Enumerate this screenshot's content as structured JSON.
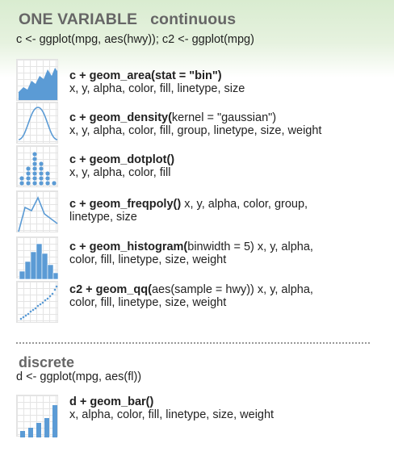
{
  "header": {
    "title_main": "ONE VARIABLE",
    "title_sub": "continuous",
    "code": "c <- ggplot(mpg, aes(hwy)); c2 <- ggplot(mpg)"
  },
  "entries": [
    {
      "call": "c + geom_area(stat = \"bin\")",
      "args_inline": "",
      "args": "x, y, alpha, color, fill,  linetype, size",
      "icon": "area-chart-icon"
    },
    {
      "call": "c + geom_density(",
      "args_inline": "kernel = \"gaussian\")",
      "args": "x, y, alpha, color, fill, group, linetype, size, weight",
      "icon": "density-curve-icon"
    },
    {
      "call": "c + geom_dotplot()",
      "args_inline": "",
      "args": "x, y, alpha, color, fill",
      "icon": "dotplot-icon"
    },
    {
      "call": "c + geom_freqpoly()",
      "args_inline": " x, y, alpha, color, group,",
      "args": "linetype, size",
      "icon": "freqpoly-icon"
    },
    {
      "call": "c + geom_histogram(",
      "args_inline": "binwidth = 5) x, y, alpha,",
      "args": "color, fill, linetype, size, weight",
      "icon": "histogram-icon"
    },
    {
      "call": "c2 + geom_qq(",
      "args_inline": "aes(sample = hwy)) x, y, alpha,",
      "args": "color, fill, linetype, size, weight",
      "icon": "qq-plot-icon"
    }
  ],
  "discrete": {
    "title": "discrete",
    "code": "d <- ggplot(mpg, aes(fl))",
    "entry": {
      "call": "d + geom_bar()",
      "args": "x, alpha, color, fill, linetype, size, weight",
      "icon": "bar-chart-icon"
    }
  },
  "colors": {
    "accent_blue": "#5b9bd5",
    "header_green": "#d9ecd0",
    "title_gray": "#666666"
  }
}
